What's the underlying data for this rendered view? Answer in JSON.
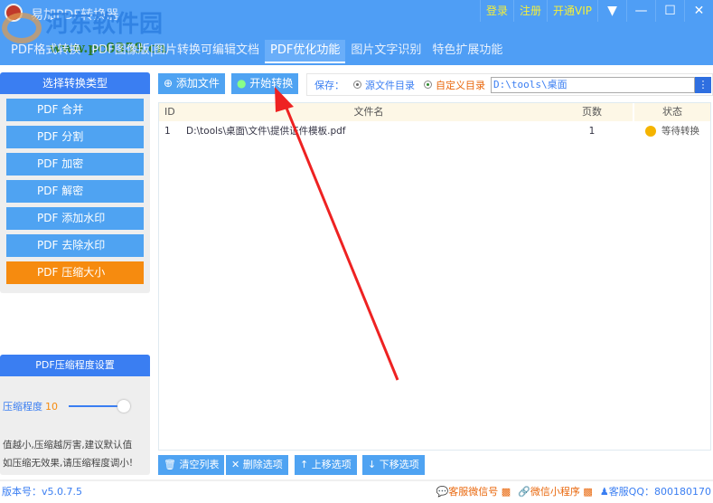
{
  "app": {
    "title": "易加PDF转换器",
    "watermark": "河东软件园",
    "watermark_url": "www.pc0359.cn"
  },
  "topbar": {
    "login": "登录",
    "register": "注册",
    "vip": "开通VIP"
  },
  "tabs": [
    {
      "label": "PDF格式转换"
    },
    {
      "label": "PDF图像版|图片转换可编辑文档"
    },
    {
      "label": "PDF优化功能"
    },
    {
      "label": "图片文字识别"
    },
    {
      "label": "特色扩展功能"
    }
  ],
  "sidebar": {
    "header": "选择转换类型",
    "items": [
      {
        "label": "PDF 合并"
      },
      {
        "label": "PDF 分割"
      },
      {
        "label": "PDF 加密"
      },
      {
        "label": "PDF 解密"
      },
      {
        "label": "PDF 添加水印"
      },
      {
        "label": "PDF 去除水印"
      },
      {
        "label": "PDF 压缩大小"
      }
    ]
  },
  "compress": {
    "header": "PDF压缩程度设置",
    "label": "压缩程度",
    "value": "10",
    "level": 10,
    "note1": "值越小,压缩越厉害,建议默认值",
    "note2": "如压缩无效果,请压缩程度调小!"
  },
  "toolbar": {
    "add": "添加文件",
    "start": "开始转换",
    "save_label": "保存：",
    "opt_source": "源文件目录",
    "opt_custom": "自定义目录",
    "path": "D:\\tools\\桌面",
    "more": "⋮"
  },
  "table": {
    "headers": [
      "ID",
      "文件名",
      "页数",
      "状态"
    ],
    "rows": [
      {
        "id": "1",
        "name": "D:\\tools\\桌面\\文件\\提供证件模板.pdf",
        "pages": "1",
        "status": "等待转换"
      }
    ]
  },
  "bottom": {
    "clear": "清空列表",
    "delete": "删除选项",
    "up": "上移选项",
    "down": "下移选项"
  },
  "footer": {
    "version": "版本号：v5.0.7.5",
    "wechat": "客服微信号",
    "mini": "微信小程序",
    "qq": "客服QQ：800180170"
  }
}
